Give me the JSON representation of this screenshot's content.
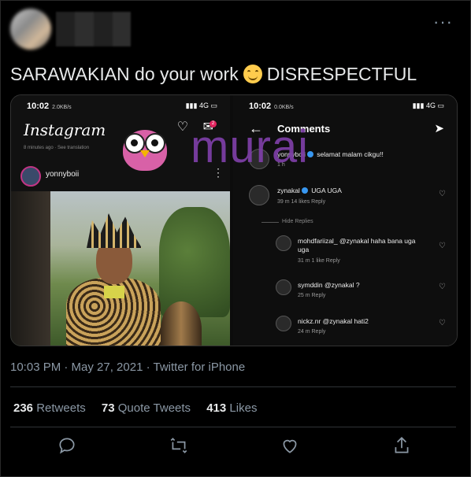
{
  "tweet": {
    "text_before_emoji": "SARAWAKIAN do your work",
    "emoji_icon": "smiling-face-emoji",
    "text_after_emoji": "DISRESPECTFUL",
    "timestamp": "10:03 PM · May 27, 2021 · Twitter for iPhone",
    "more_icon": "···"
  },
  "stats": {
    "retweets_count": "236",
    "retweets_label": "Retweets",
    "quotes_count": "73",
    "quotes_label": "Quote Tweets",
    "likes_count": "413",
    "likes_label": "Likes"
  },
  "media": {
    "left": {
      "time": "10:02",
      "speed": "2.0KB/s",
      "network": "4G",
      "app_title": "Instagram",
      "subtitle": "8 minutes ago · See translation",
      "username": "yonnyboii",
      "badge": "2"
    },
    "right": {
      "time": "10:02",
      "speed": "0.0KB/s",
      "network": "4G",
      "title": "Comments",
      "comments": [
        {
          "user": "yonnyboii",
          "text": "selamat malam cikgu!!",
          "meta": "1 h"
        },
        {
          "user": "zynakal",
          "text": "UGA UGA",
          "meta": "39 m    14 likes    Reply"
        },
        {
          "user": "mohdfariizal_",
          "text": "@zynakal haha bana uga uga",
          "meta": "31 m    1 like    Reply"
        },
        {
          "user": "symddin",
          "text": "@zynakal ?",
          "meta": "25 m    Reply"
        },
        {
          "user": "nickz.nr",
          "text": "@zynakal hati2",
          "meta": "24 m    Reply"
        }
      ],
      "hide_replies": "Hide Replies"
    },
    "watermark": "murai"
  },
  "colors": {
    "accent": "#1d9bf0",
    "watermark": "#7e3fa8",
    "background": "#000000"
  }
}
